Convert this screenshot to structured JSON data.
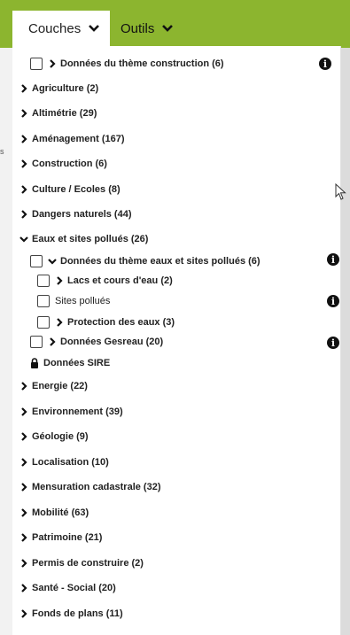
{
  "tabs": {
    "couches_label": "Couches",
    "outils_label": "Outils"
  },
  "layers": {
    "theme_construction": "Données du thème construction (6)",
    "agriculture": "Agriculture (2)",
    "altimetrie": "Altimétrie (29)",
    "amenagement": "Aménagement (167)",
    "construction": "Construction (6)",
    "culture": "Culture / Ecoles (8)",
    "dangers": "Dangers naturels (44)",
    "eaux": "Eaux et sites pollués (26)",
    "theme_eaux": "Données du thème eaux et sites pollués (6)",
    "lacs": "Lacs et cours d'eau (2)",
    "sites_pollues": "Sites pollués",
    "protection": "Protection des eaux (3)",
    "gesreau": "Données Gesreau (20)",
    "sire": "Données SIRE",
    "energie": "Energie (22)",
    "environnement": "Environnement (39)",
    "geologie": "Géologie (9)",
    "localisation": "Localisation (10)",
    "mensuration": "Mensuration cadastrale (32)",
    "mobilite": "Mobilité (63)",
    "patrimoine": "Patrimoine (21)",
    "permis": "Permis de construire (2)",
    "sante": "Santé - Social (20)",
    "fonds": "Fonds de plans (11)"
  },
  "info_glyph": "i",
  "stray_mark": "s",
  "colors": {
    "topbar": "#8cb52f",
    "panel": "#ffffff"
  }
}
